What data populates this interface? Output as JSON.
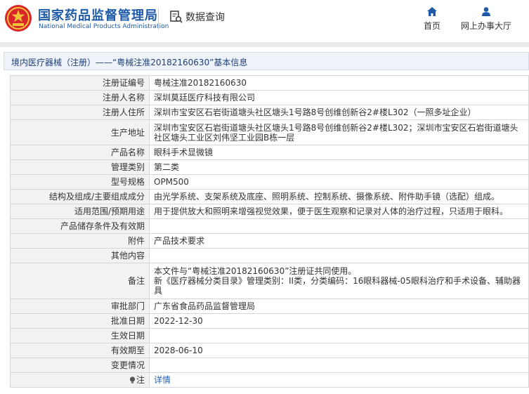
{
  "header": {
    "brand_cn": "国家药品监督管理局",
    "brand_en": "National Medical Products Administration",
    "query_label": "数据查询",
    "nav": [
      {
        "label": "首页",
        "icon": "home-icon"
      },
      {
        "label": "网上办事大厅",
        "icon": "user-icon"
      }
    ]
  },
  "breadcrumb": "境内医疗器械（注册）——“粤械注准20182160630”基本信息",
  "rows": [
    {
      "key": "注册证编号",
      "value": "粤械注准20182160630"
    },
    {
      "key": "注册人名称",
      "value": "深圳莫廷医疗科技有限公司"
    },
    {
      "key": "注册人住所",
      "value": "深圳市宝安区石岩街道塘头社区塘头1号路8号创维创新谷2#楼L302（一照多址企业）"
    },
    {
      "key": "生产地址",
      "value": "深圳市宝安区石岩街道塘头社区塘头1号路8号创维创新谷2#楼L302；深圳市宝安区石岩街道塘头社区塘头工业区刘伟坚工业园B栋一层"
    },
    {
      "key": "产品名称",
      "value": "眼科手术显微镜"
    },
    {
      "key": "管理类别",
      "value": "第二类"
    },
    {
      "key": "型号规格",
      "value": "OPM500"
    },
    {
      "key": "结构及组成/主要组成成分",
      "value": "由光学系统、支架系统及底座、照明系统、控制系统、摄像系统、附件助手镜（选配）组成。"
    },
    {
      "key": "适用范围/预期用途",
      "value": "用于提供放大和照明来增强视觉效果，便于医生观察和记录对人体的治疗过程，只适用于眼科。"
    },
    {
      "key": "产品储存条件及有效期",
      "value": ""
    },
    {
      "key": "附件",
      "value": "产品技术要求"
    },
    {
      "key": "其他内容",
      "value": ""
    },
    {
      "key": "备注",
      "value": "本文件与“粤械注准20182160630”注册证共同使用。\n新《医疗器械分类目录》管理类别：II类，分类编码：16眼科器械-05眼科治疗和手术设备、辅助器具"
    },
    {
      "key": "审批部门",
      "value": "广东省食品药品监督管理局"
    },
    {
      "key": "批准日期",
      "value": "2022-12-30"
    },
    {
      "key": "生效日期",
      "value": ""
    },
    {
      "key": "有效期至",
      "value": "2028-06-10"
    },
    {
      "key": "变更情况",
      "value": ""
    }
  ],
  "note_row": {
    "key": "注",
    "link": "详情",
    "icon": "lightbulb-icon"
  },
  "colors": {
    "brand": "#1e5aa8",
    "emblem_red": "#d8262a",
    "link": "#1e64b4"
  }
}
